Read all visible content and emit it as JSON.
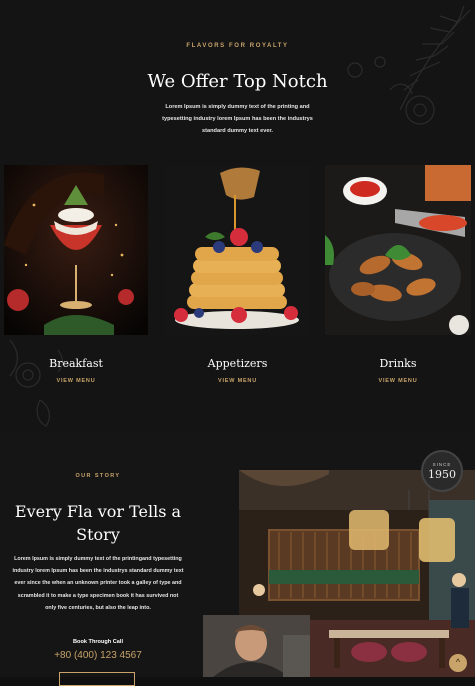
{
  "hero": {
    "kicker": "FLAVORS FOR ROYALTY",
    "title": "We Offer Top Notch",
    "description": "Lorem Ipsum is simply dummy text of the printing and typesetting industry lorem Ipsum has been the industrys standard dummy text ever."
  },
  "menu": {
    "items": [
      {
        "title": "Breakfast",
        "link": "VIEW MENU"
      },
      {
        "title": "Appetizers",
        "link": "VIEW MENU"
      },
      {
        "title": "Drinks",
        "link": "VIEW MENU"
      }
    ]
  },
  "story": {
    "kicker": "OUR STORY",
    "title": "Every Fla vor Tells a Story",
    "description": "Lorem Ipsum is simply dummy text of the printingand typesetting industry lorem Ipsum has been the industrys standard dummy text ever since the when an unknown printer took a galley of type and scrambled it to make a type specimen book it has survived not only five centuries, but also the leap into.",
    "book_label": "Book Through Call",
    "phone": "+80 (400) 123 4567"
  },
  "badge": {
    "small": "SINCE",
    "year": "1950"
  },
  "scroll_top": {
    "icon": "^"
  },
  "colors": {
    "accent": "#c9a46a",
    "background": "#141414"
  }
}
